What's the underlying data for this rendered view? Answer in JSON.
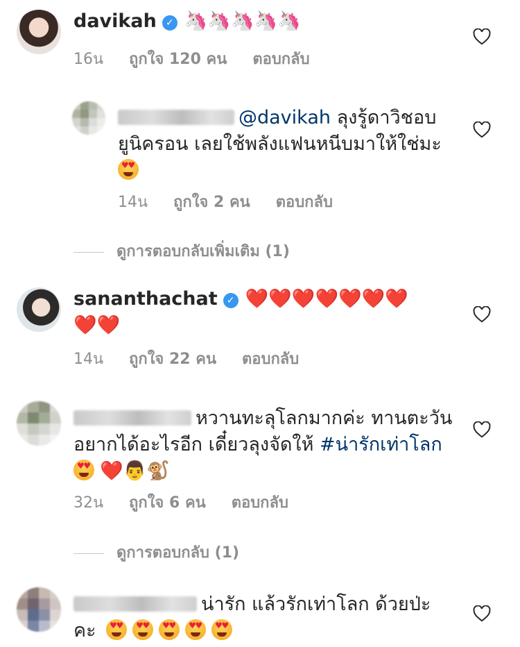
{
  "comments": [
    {
      "username": "davikah",
      "verified": true,
      "text": "🦄🦄🦄🦄🦄",
      "time": "16น",
      "likes": "ถูกใจ 120 คน",
      "reply_label": "ตอบกลับ"
    },
    {
      "mention": "@davikah",
      "text_line1": "ลุงรู้ดาวิชอบ",
      "text_line2": "ยูนิครอน เลยใช้พลังแฟนหนีบมาให้ใช่มะ",
      "time": "14น",
      "likes": "ถูกใจ 2 คน",
      "reply_label": "ตอบกลับ"
    },
    {
      "more_replies": "ดูการตอบกลับเพิ่มเติม (1)"
    },
    {
      "username": "sananthachat",
      "verified": true,
      "time": "14น",
      "likes": "ถูกใจ 22 คน",
      "reply_label": "ตอบกลับ"
    },
    {
      "text_line1": "หวานทะลุโลกมากค่ะ ทานตะวัน",
      "text_line2": "อยากได้อะไรอีก เดี๋ยวลุงจัดให้",
      "hashtag": "#น่ารักเท่าโลก",
      "time": "32น",
      "likes": "ถูกใจ 6 คน",
      "reply_label": "ตอบกลับ"
    },
    {
      "more_replies": "ดูการตอบกลับ (1)"
    },
    {
      "text_line1": "น่ารัก แล้วรักเท่าโลก ด้วยป่ะ",
      "text_line2": "คะ"
    }
  ],
  "colors": {
    "link": "#003569",
    "meta": "#8e8e8e",
    "verified": "#3897f0",
    "heart": "#e0243a"
  },
  "icons": {
    "like": "heart-outline-icon",
    "verified": "verified-badge-icon"
  }
}
